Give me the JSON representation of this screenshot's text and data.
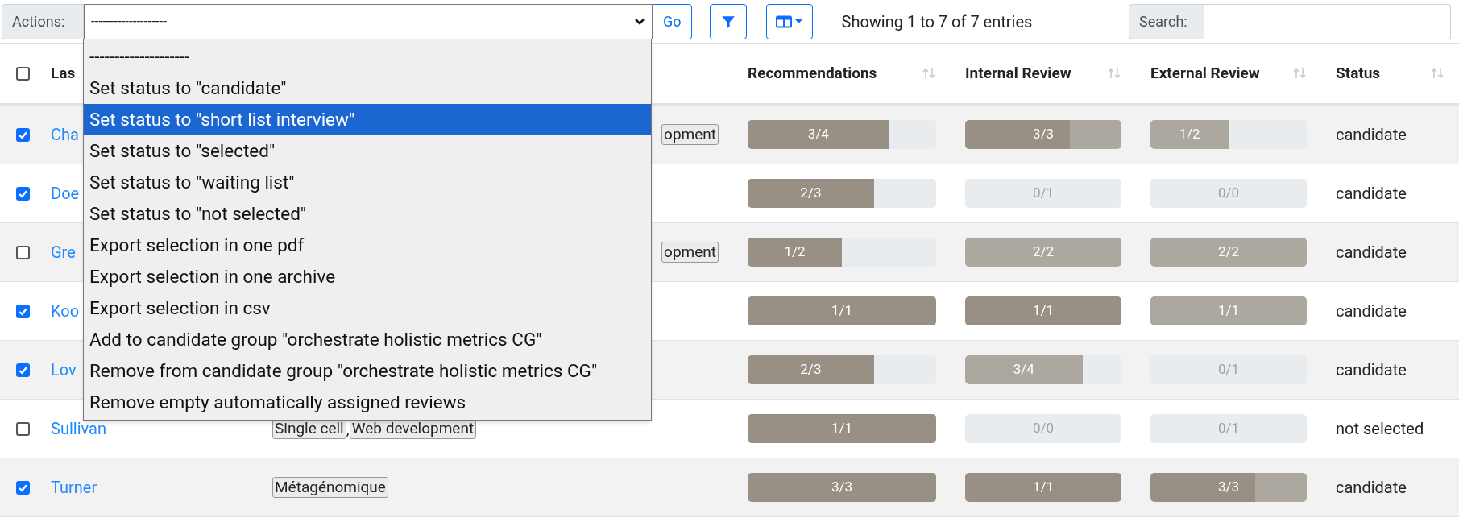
{
  "toolbar": {
    "actions_label": "Actions:",
    "actions_value": "--------------------",
    "go_button": "Go",
    "summary": "Showing 1 to 7 of 7 entries",
    "search_label": "Search:"
  },
  "actions_menu": {
    "expanded": true,
    "items": [
      {
        "label": "--------------------",
        "selected": false
      },
      {
        "label": "Set status to \"candidate\"",
        "selected": false
      },
      {
        "label": "Set status to \"short list interview\"",
        "selected": true
      },
      {
        "label": "Set status to \"selected\"",
        "selected": false
      },
      {
        "label": "Set status to \"waiting list\"",
        "selected": false
      },
      {
        "label": "Set status to \"not selected\"",
        "selected": false
      },
      {
        "label": "Export selection in one pdf",
        "selected": false
      },
      {
        "label": "Export selection in one archive",
        "selected": false
      },
      {
        "label": "Export selection in csv",
        "selected": false
      },
      {
        "label": "Add to candidate group \"orchestrate holistic metrics CG\"",
        "selected": false
      },
      {
        "label": "Remove from candidate group \"orchestrate holistic metrics CG\"",
        "selected": false
      },
      {
        "label": "Remove empty automatically assigned reviews",
        "selected": false
      }
    ]
  },
  "table": {
    "select_all_checked": false,
    "tag_separator": ",",
    "columns": [
      {
        "label": "Las",
        "sortable": false
      },
      {
        "label": "Recommendations",
        "sortable": true
      },
      {
        "label": "Internal Review",
        "sortable": true
      },
      {
        "label": "External Review",
        "sortable": true
      },
      {
        "label": "Status",
        "sortable": true
      }
    ],
    "rows": [
      {
        "checked": true,
        "name": "Cha",
        "tags": [
          "opment"
        ],
        "tags_clipped": true,
        "reviews": [
          {
            "text": "3/4",
            "segments": [
              {
                "kind": "done",
                "level": 0.75
              }
            ]
          },
          {
            "text": "3/3",
            "segments": [
              {
                "kind": "done",
                "level": 0.67
              },
              {
                "kind": "pending",
                "level": 0.33
              }
            ]
          },
          {
            "text": "1/2",
            "segments": [
              {
                "kind": "pending",
                "level": 0.5
              }
            ]
          }
        ],
        "status": "candidate"
      },
      {
        "checked": true,
        "name": "Doe",
        "tags": [],
        "reviews": [
          {
            "text": "2/3",
            "segments": [
              {
                "kind": "done",
                "level": 0.67
              }
            ]
          },
          {
            "text": "0/1",
            "segments": [
              {
                "kind": "done",
                "level": 0
              }
            ]
          },
          {
            "text": "0/0",
            "segments": [
              {
                "kind": "done",
                "level": 0
              }
            ]
          }
        ],
        "status": "candidate"
      },
      {
        "checked": false,
        "name": "Gre",
        "tags": [
          "opment"
        ],
        "tags_clipped": true,
        "reviews": [
          {
            "text": "1/2",
            "segments": [
              {
                "kind": "done",
                "level": 0.5
              }
            ]
          },
          {
            "text": "2/2",
            "segments": [
              {
                "kind": "pending",
                "level": 1
              }
            ]
          },
          {
            "text": "2/2",
            "segments": [
              {
                "kind": "pending",
                "level": 1
              }
            ]
          }
        ],
        "status": "candidate"
      },
      {
        "checked": true,
        "name": "Koo",
        "tags": [],
        "reviews": [
          {
            "text": "1/1",
            "segments": [
              {
                "kind": "done",
                "level": 1
              }
            ]
          },
          {
            "text": "1/1",
            "segments": [
              {
                "kind": "done",
                "level": 1
              }
            ]
          },
          {
            "text": "1/1",
            "segments": [
              {
                "kind": "pending",
                "level": 1
              }
            ]
          }
        ],
        "status": "candidate"
      },
      {
        "checked": true,
        "name": "Lov",
        "tags": [],
        "reviews": [
          {
            "text": "2/3",
            "segments": [
              {
                "kind": "done",
                "level": 0.67
              }
            ]
          },
          {
            "text": "3/4",
            "segments": [
              {
                "kind": "pending",
                "level": 0.75
              }
            ]
          },
          {
            "text": "0/1",
            "segments": [
              {
                "kind": "done",
                "level": 0
              }
            ]
          }
        ],
        "status": "candidate"
      },
      {
        "checked": false,
        "name": "Sullivan",
        "tags": [
          "Single cell",
          "Web development"
        ],
        "reviews": [
          {
            "text": "1/1",
            "segments": [
              {
                "kind": "done",
                "level": 1
              }
            ]
          },
          {
            "text": "0/0",
            "segments": [
              {
                "kind": "done",
                "level": 0
              }
            ]
          },
          {
            "text": "0/1",
            "segments": [
              {
                "kind": "done",
                "level": 0
              }
            ]
          }
        ],
        "status": "not selected"
      },
      {
        "checked": true,
        "name": "Turner",
        "tags": [
          "Métagénomique"
        ],
        "reviews": [
          {
            "text": "3/3",
            "segments": [
              {
                "kind": "done",
                "level": 1
              }
            ]
          },
          {
            "text": "1/1",
            "segments": [
              {
                "kind": "done",
                "level": 1
              }
            ]
          },
          {
            "text": "3/3",
            "segments": [
              {
                "kind": "done",
                "level": 0.67
              },
              {
                "kind": "pending",
                "level": 0.33
              }
            ]
          }
        ],
        "status": "candidate"
      }
    ]
  }
}
